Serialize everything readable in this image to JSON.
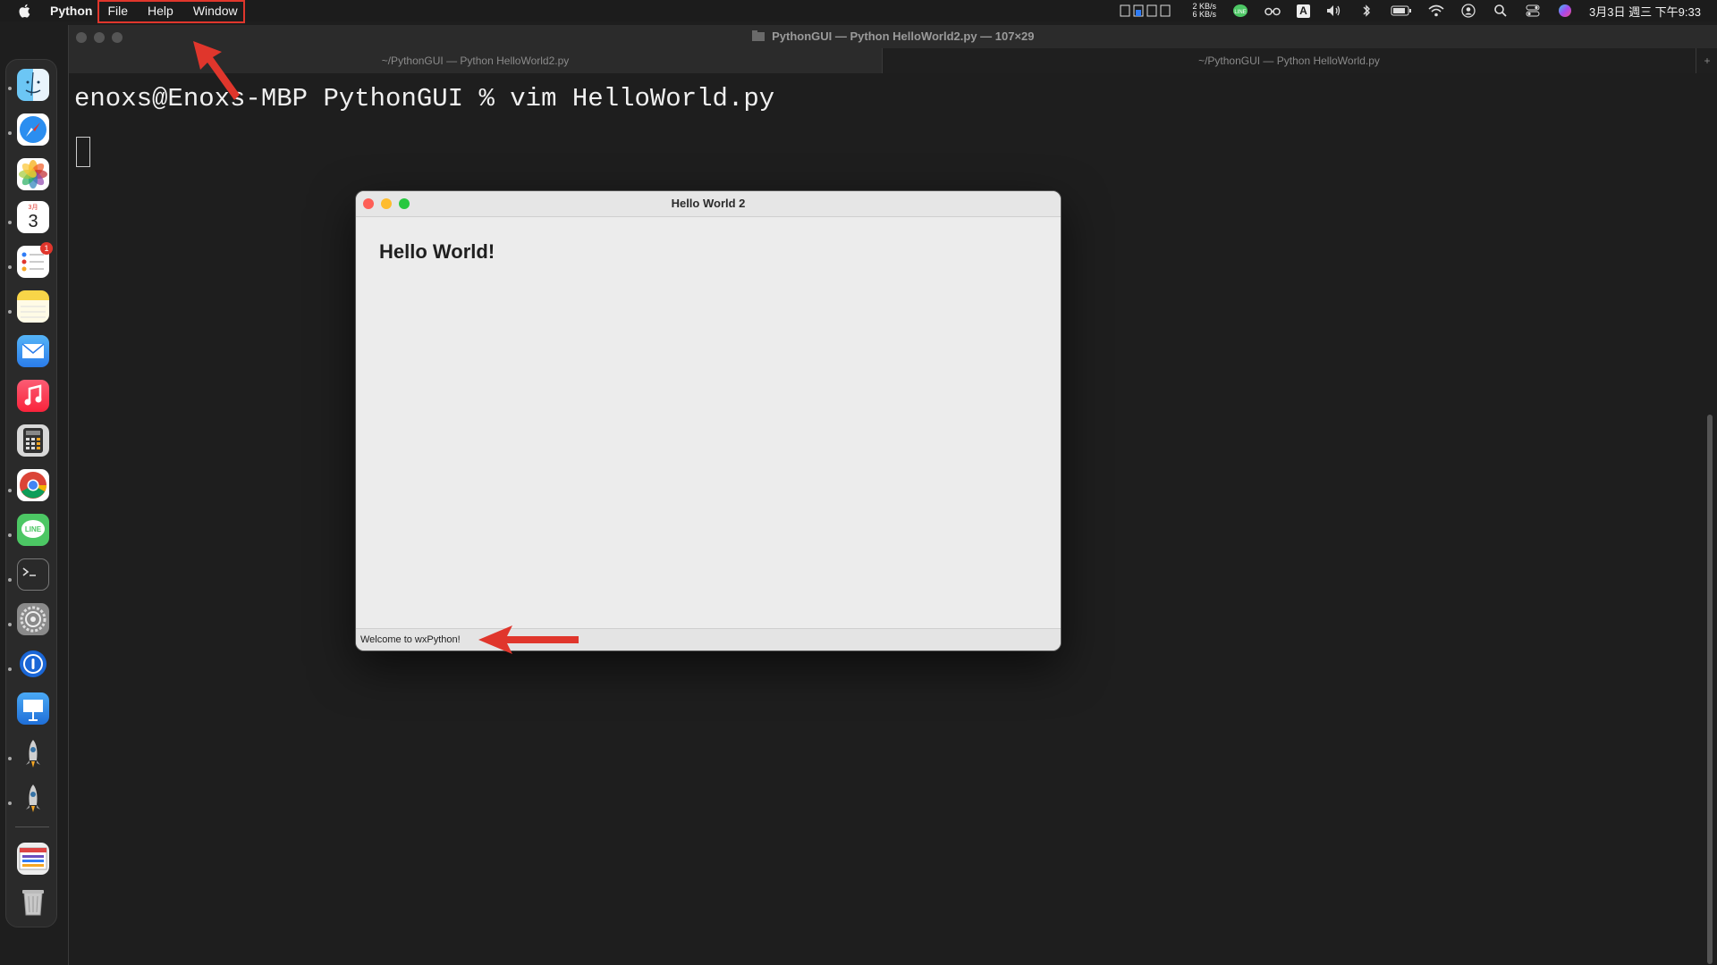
{
  "menubar": {
    "app_name": "Python",
    "menus": [
      "File",
      "Help",
      "Window"
    ],
    "network": {
      "up": "2 KB/s",
      "down": "6 KB/s"
    },
    "input_source": "A",
    "clock": "3月3日 週三 下午9:33"
  },
  "terminal": {
    "window_title": "PythonGUI — Python HelloWorld2.py — 107×29",
    "tabs": [
      "~/PythonGUI — Python HelloWorld2.py",
      "~/PythonGUI — Python HelloWorld.py"
    ],
    "tab_plus": "+",
    "prompt_line": "enoxs@Enoxs-MBP PythonGUI % vim HelloWorld.py"
  },
  "wx_window": {
    "title": "Hello World 2",
    "heading": "Hello World!",
    "status_text": "Welcome to wxPython!"
  },
  "dock": {
    "items": [
      "Finder",
      "Safari",
      "Photos",
      "Calendar",
      "Reminders",
      "Notes",
      "Mail",
      "Music",
      "Calculator",
      "Chrome",
      "LINE",
      "Terminal",
      "System Preferences",
      "1Password",
      "Keynote",
      "Python Launcher",
      "Python Launcher",
      "Screenshot",
      "Trash"
    ],
    "calendar": {
      "month": "3月",
      "day": "3"
    },
    "reminders_badge": "1",
    "line_label": "LINE"
  },
  "colors": {
    "annotation_red": "#e0362c",
    "accent": "#2f7cf6"
  }
}
